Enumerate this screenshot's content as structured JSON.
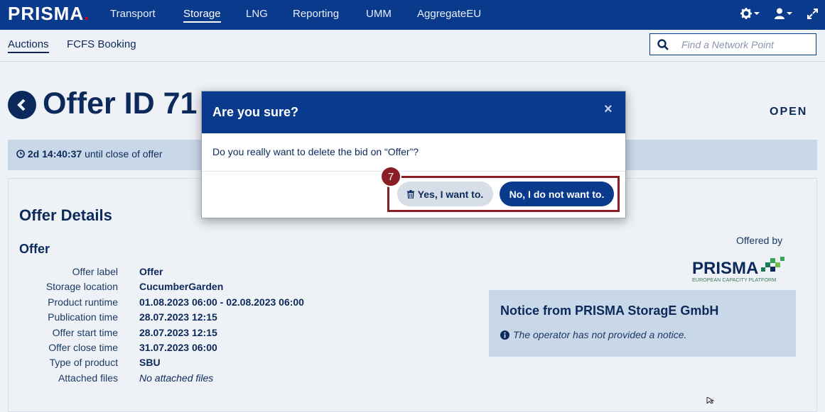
{
  "nav": {
    "logo": "PRISMA",
    "logo_dot": ".",
    "items": [
      "Transport",
      "Storage",
      "LNG",
      "Reporting",
      "UMM",
      "AggregateEU"
    ],
    "active": "Storage"
  },
  "subnav": {
    "items": [
      "Auctions",
      "FCFS Booking"
    ],
    "active": "Auctions",
    "search_placeholder": "Find a Network Point"
  },
  "page": {
    "title": "Offer ID 71",
    "status": "OPEN",
    "timer_value": "2d 14:40:37",
    "timer_suffix": "until close of offer"
  },
  "details": {
    "heading": "Offer Details",
    "subheading": "Offer",
    "rows": [
      {
        "label": "Offer label",
        "value": "Offer"
      },
      {
        "label": "Storage location",
        "value": "CucumberGarden"
      },
      {
        "label": "Product runtime",
        "value": "01.08.2023 06:00 - 02.08.2023 06:00"
      },
      {
        "label": "Publication time",
        "value": "28.07.2023 12:15"
      },
      {
        "label": "Offer start time",
        "value": "28.07.2023 12:15"
      },
      {
        "label": "Offer close time",
        "value": "31.07.2023 06:00"
      },
      {
        "label": "Type of product",
        "value": "SBU"
      },
      {
        "label": "Attached files",
        "value": "No attached files"
      }
    ],
    "offered_by": "Offered by",
    "provider_logo_text": "PRISMA",
    "provider_logo_sub": "EUROPEAN CAPACITY PLATFORM"
  },
  "notice": {
    "title": "Notice from PRISMA StoragE GmbH",
    "message": "The operator has not provided a notice."
  },
  "modal": {
    "title": "Are you sure?",
    "close": "×",
    "message": "Do you really want to delete the bid on “Offer”?",
    "yes_label": "Yes, I want to.",
    "no_label": "No, I do not want to.",
    "step_number": "7"
  },
  "colors": {
    "nav_bg": "#0a3a8c",
    "brand_red": "#d6001c",
    "highlight": "#8a1e24",
    "panel_blue": "#c9d8e8"
  }
}
